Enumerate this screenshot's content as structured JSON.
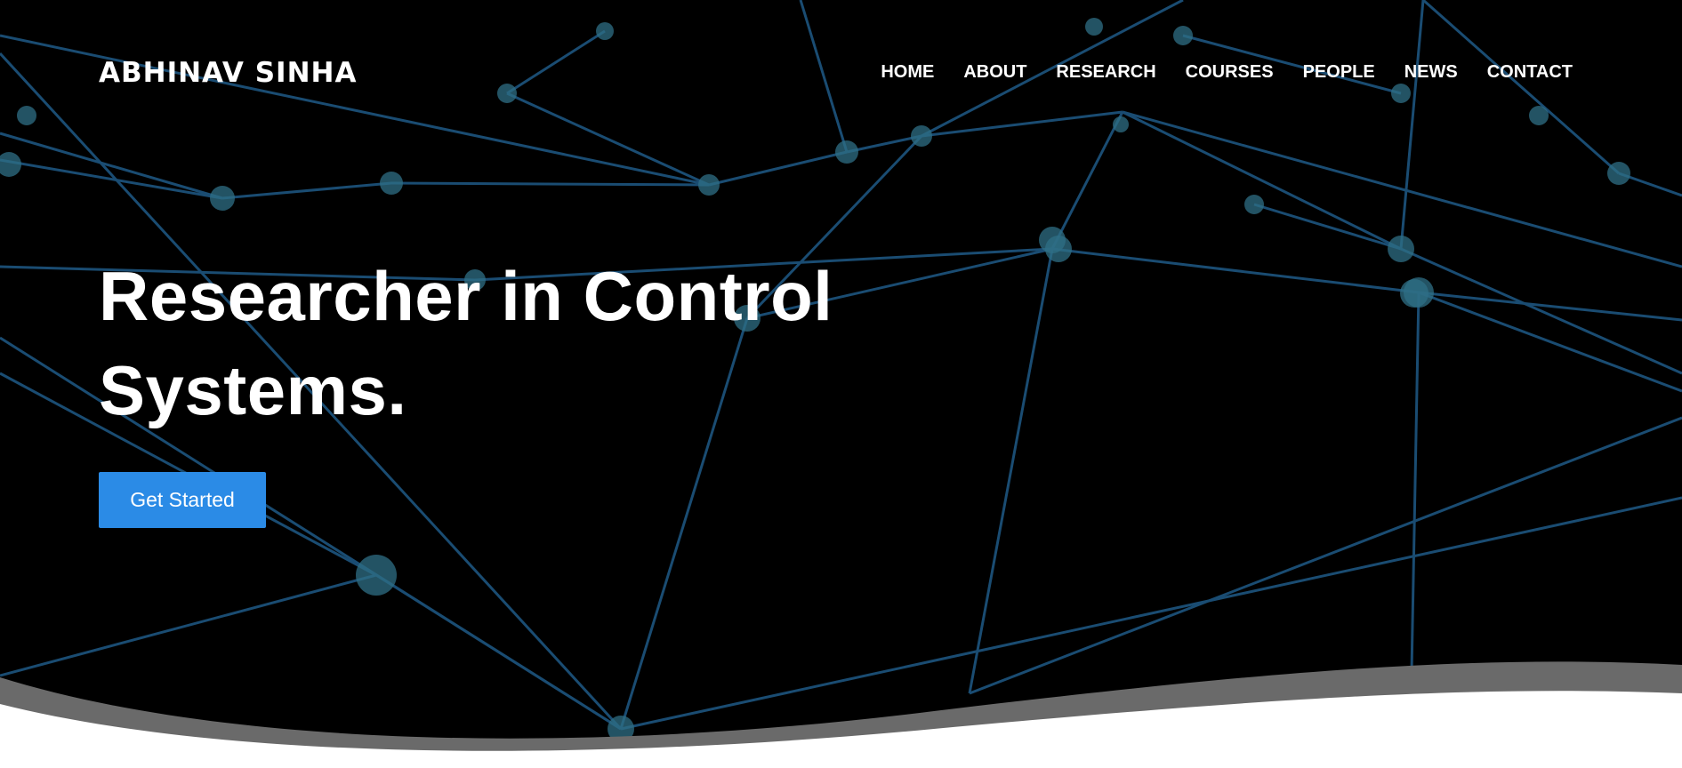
{
  "header": {
    "brand": "ABHINAV SINHA",
    "nav": [
      "HOME",
      "ABOUT",
      "RESEARCH",
      "COURSES",
      "PEOPLE",
      "NEWS",
      "CONTACT"
    ]
  },
  "hero": {
    "headline": "Researcher in Control Systems.",
    "cta_label": "Get Started"
  },
  "colors": {
    "background": "#000000",
    "network_line": "#1f5a86",
    "network_node": "#2f6f86",
    "cta": "#2b8be6",
    "wave_shadow": "#6a6a6a",
    "wave_fill": "#ffffff"
  }
}
